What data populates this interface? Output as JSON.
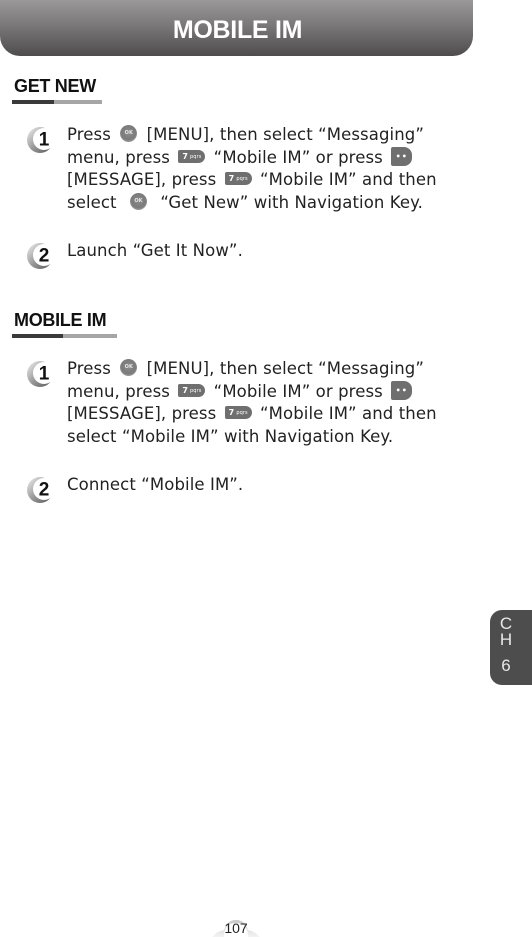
{
  "header": {
    "title": "MOBILE IM"
  },
  "sections": [
    {
      "title": "GET NEW",
      "steps": [
        {
          "number": "1",
          "parts": {
            "p1": "Press",
            "p2": "[MENU], then select “Messaging” menu, press",
            "p3": "“Mobile IM” or press",
            "p4": "[MESSAGE], press",
            "p5": "“Mobile IM” and then select",
            "p6": "“Get New” with Navigation Key."
          }
        },
        {
          "number": "2",
          "text": "Launch “Get It Now”."
        }
      ]
    },
    {
      "title": "MOBILE IM",
      "steps": [
        {
          "number": "1",
          "parts": {
            "p1": "Press",
            "p2": "[MENU], then select “Messaging” menu, press",
            "p3": "“Mobile IM” or press",
            "p4": "[MESSAGE], press",
            "p5": "“Mobile IM” and then select “Mobile IM” with Navigation Key."
          }
        },
        {
          "number": "2",
          "text": "Connect “Mobile IM”."
        }
      ]
    }
  ],
  "keys": {
    "ok": {
      "icon": "ok-key-icon",
      "label": "OK"
    },
    "seven": {
      "icon": "seven-pqrs-key-icon",
      "digit": "7",
      "letters": "pqrs"
    },
    "message": {
      "icon": "message-soft-key-icon",
      "label": "••"
    }
  },
  "chapter_tab": {
    "letters": "CH",
    "number": "6"
  },
  "page_number": "107",
  "colors": {
    "header_dark": "#4e4c4c",
    "header_light": "#9a9898",
    "tab": "#4d4d4d"
  }
}
